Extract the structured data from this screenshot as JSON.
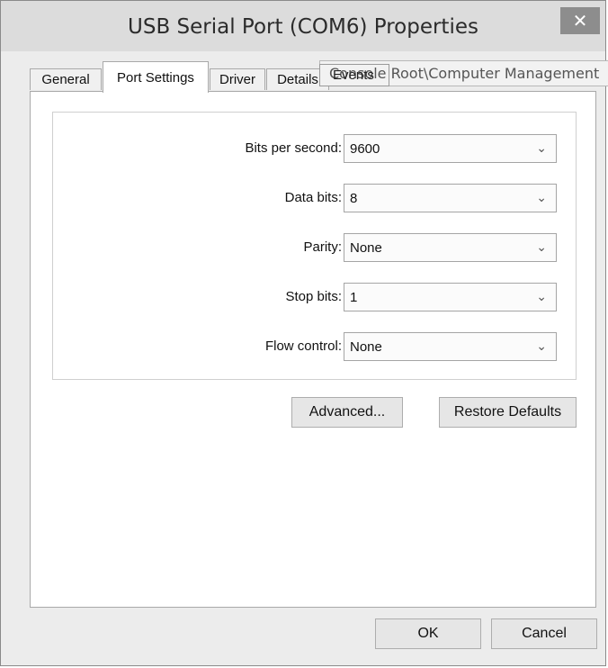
{
  "window": {
    "title": "USB Serial Port (COM6) Properties",
    "close_glyph": "✕"
  },
  "tabs": [
    {
      "label": "General"
    },
    {
      "label": "Port Settings"
    },
    {
      "label": "Driver"
    },
    {
      "label": "Details"
    },
    {
      "label": "Events"
    }
  ],
  "overlay": {
    "text": "Console Root\\Computer Management"
  },
  "port_settings": {
    "fields": [
      {
        "label": "Bits per second:",
        "value": "9600"
      },
      {
        "label": "Data bits:",
        "value": "8"
      },
      {
        "label": "Parity:",
        "value": "None"
      },
      {
        "label": "Stop bits:",
        "value": "1"
      },
      {
        "label": "Flow control:",
        "value": "None"
      }
    ],
    "chevron_glyph": "⌄"
  },
  "buttons": {
    "advanced": "Advanced...",
    "restore_defaults": "Restore Defaults",
    "ok": "OK",
    "cancel": "Cancel"
  }
}
